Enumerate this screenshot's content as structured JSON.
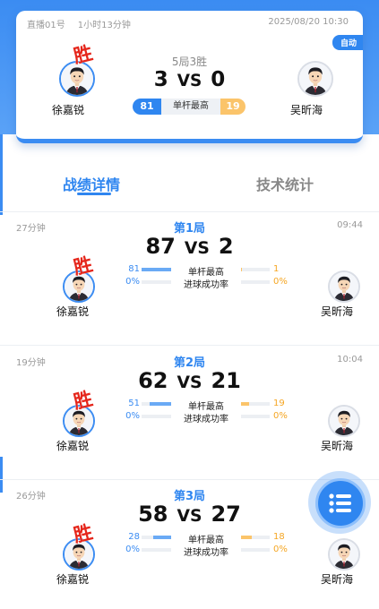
{
  "match": {
    "room": "直播01号",
    "duration": "1小时13分钟",
    "datetime": "2025/08/20 10:30",
    "mode_badge": "自动",
    "format": "5局3胜",
    "score_left": "3",
    "vs": "VS",
    "score_right": "0",
    "win_mark": "胜",
    "player_left": "徐嘉锐",
    "player_right": "吴昕海",
    "stat_label": "单杆最高",
    "stat_left": "81",
    "stat_right": "19"
  },
  "tabs": {
    "record": "战绩详情",
    "tech": "技术统计"
  },
  "games": [
    {
      "duration": "27分钟",
      "clock": "09:44",
      "title": "第1局",
      "score_left": "87",
      "vs": "VS",
      "score_right": "2",
      "win_mark": "胜",
      "player_left": "徐嘉锐",
      "player_right": "吴昕海",
      "stats": [
        {
          "label": "单杆最高",
          "left": "81",
          "right": "1",
          "left_fill": 1.0,
          "right_fill": 0.03
        },
        {
          "label": "进球成功率",
          "left": "0%",
          "right": "0%",
          "left_fill": 0,
          "right_fill": 0
        }
      ]
    },
    {
      "duration": "19分钟",
      "clock": "10:04",
      "title": "第2局",
      "score_left": "62",
      "vs": "VS",
      "score_right": "21",
      "win_mark": "胜",
      "player_left": "徐嘉锐",
      "player_right": "吴昕海",
      "stats": [
        {
          "label": "单杆最高",
          "left": "51",
          "right": "19",
          "left_fill": 0.73,
          "right_fill": 0.27
        },
        {
          "label": "进球成功率",
          "left": "0%",
          "right": "0%",
          "left_fill": 0,
          "right_fill": 0
        }
      ]
    },
    {
      "duration": "26分钟",
      "clock": "",
      "title": "第3局",
      "score_left": "58",
      "vs": "VS",
      "score_right": "27",
      "win_mark": "胜",
      "player_left": "徐嘉锐",
      "player_right": "吴昕海",
      "stats": [
        {
          "label": "单杆最高",
          "left": "28",
          "right": "18",
          "left_fill": 0.61,
          "right_fill": 0.39
        },
        {
          "label": "进球成功率",
          "left": "0%",
          "right": "0%",
          "left_fill": 0,
          "right_fill": 0
        }
      ]
    }
  ],
  "fab": {
    "icon": "list-menu-icon"
  },
  "colors": {
    "primary": "#2f86f0",
    "accent_orange": "#fbc46a",
    "win_red": "#e5261b"
  }
}
